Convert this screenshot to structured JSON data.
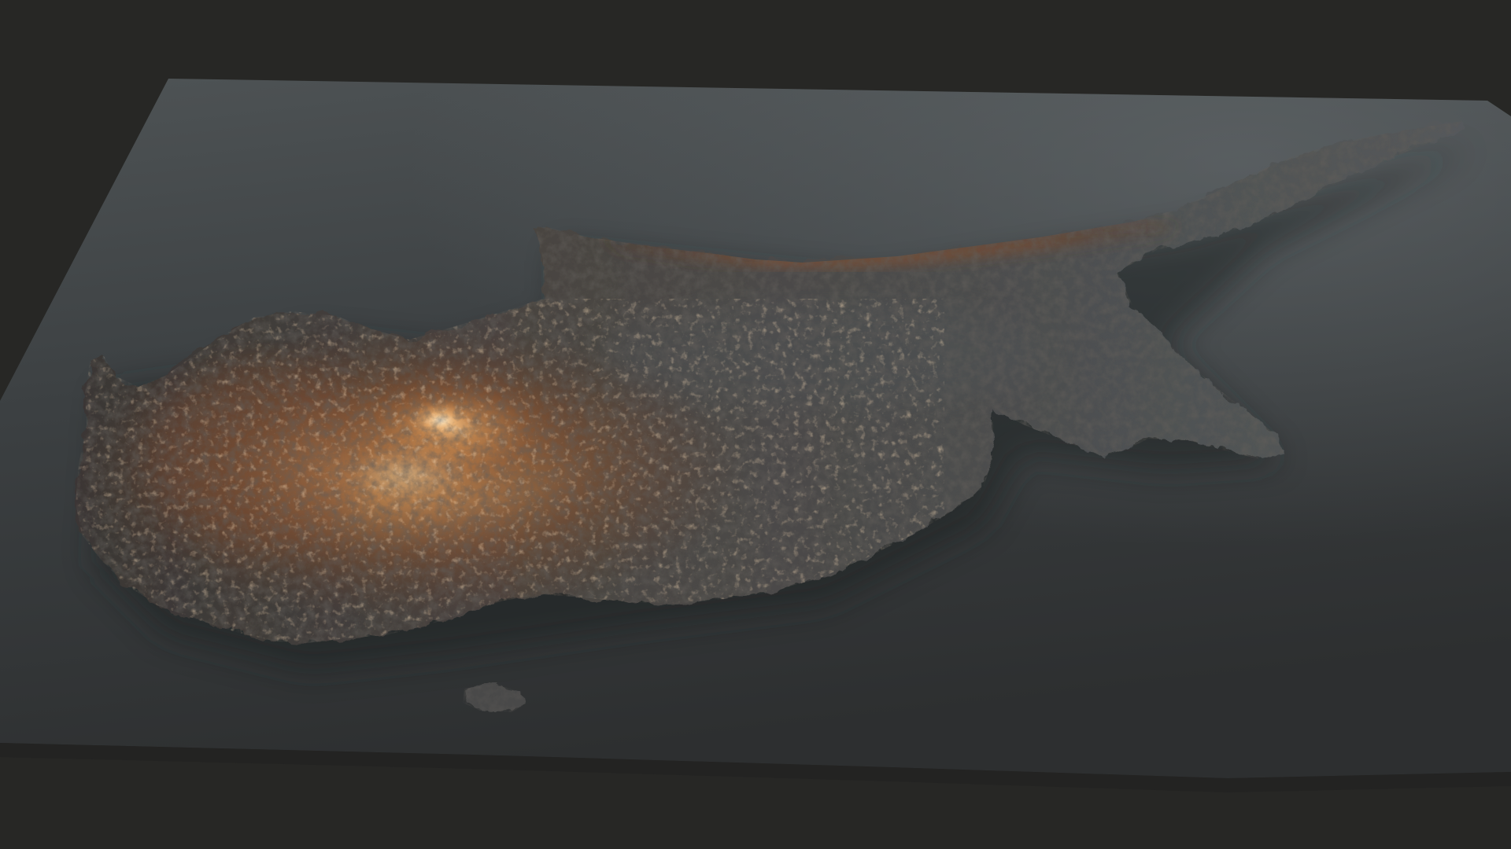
{
  "scene": {
    "background_color": "#272725",
    "base_color_far": "#4b5052",
    "base_color_near": "#2e3031",
    "land_shadow_color": "#2c2c2c",
    "land_mid_color": "#4a4644",
    "relief_copper_color": "#a46a3c",
    "relief_highlight_color": "#f2c68e",
    "ridge_glow_color": "#7a4a2c"
  }
}
